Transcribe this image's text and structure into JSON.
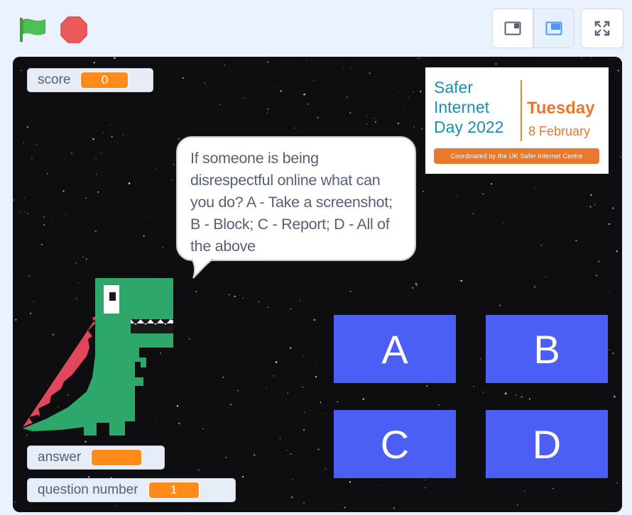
{
  "controls": {
    "green_flag": "green-flag-icon",
    "stop": "stop-icon",
    "small_stage": "small-stage-icon",
    "large_stage": "large-stage-icon",
    "fullscreen": "fullscreen-icon"
  },
  "monitors": {
    "score": {
      "label": "score",
      "value": "0"
    },
    "answer": {
      "label": "answer",
      "value": ""
    },
    "question_number": {
      "label": "question number",
      "value": "1"
    }
  },
  "speech_bubble": {
    "text": "If someone is being disrespectful online what can you do?  A - Take a screenshot; B - Block; C - Report; D - All of the above"
  },
  "banner": {
    "line1": "Safer",
    "line2": "Internet",
    "line3": "Day 2022",
    "day": "Tuesday",
    "date": "8 February",
    "strap": "Coordinated by the UK Safer Internet Centre"
  },
  "answers": [
    "A",
    "B",
    "C",
    "D"
  ],
  "colors": {
    "answer_button": "#4c5ff4",
    "monitor_value": "#ff8c1a",
    "banner_blue": "#1a8fb5",
    "banner_orange": "#e8782a",
    "dino_green": "#2ea86a",
    "dino_spikes": "#e0475c"
  }
}
